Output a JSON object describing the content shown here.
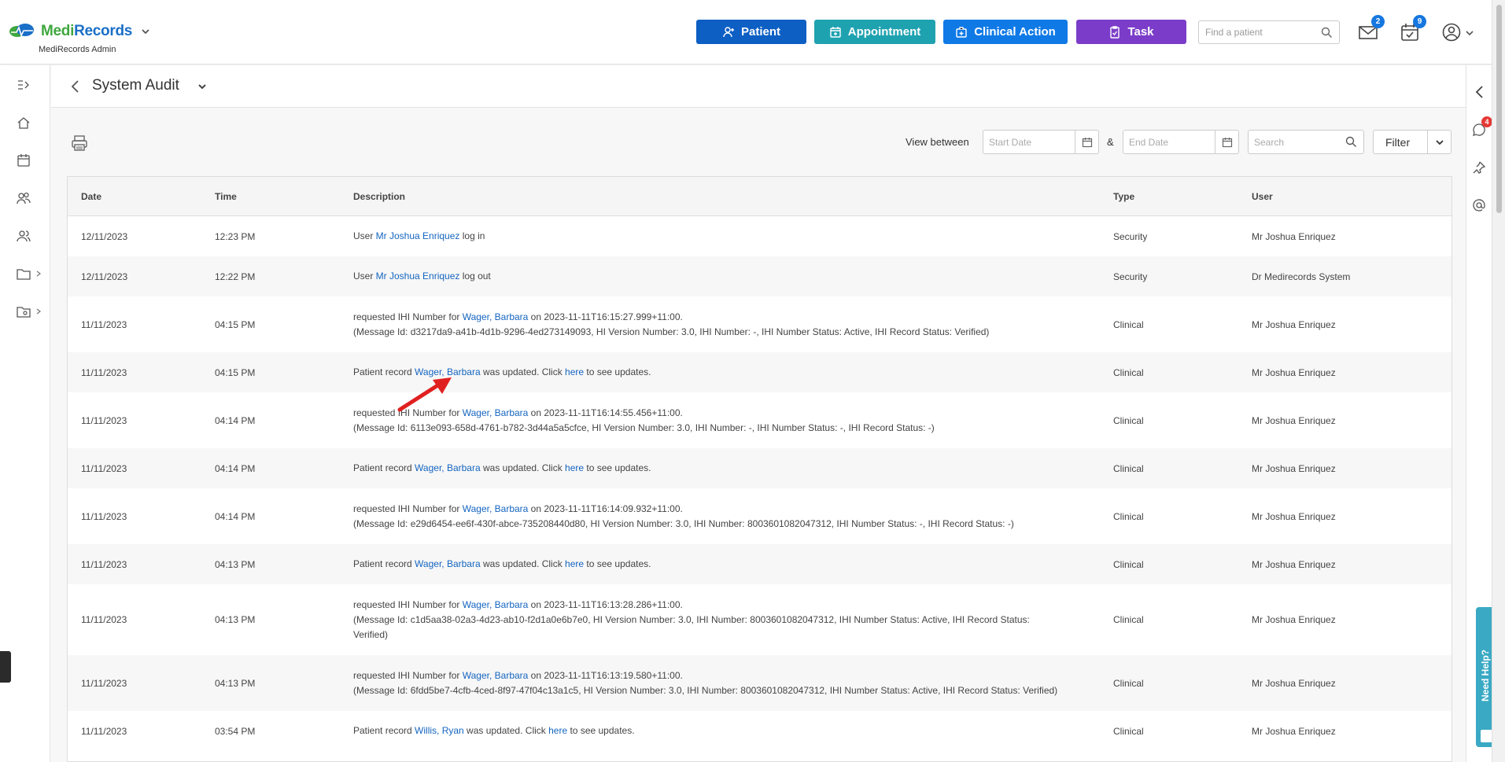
{
  "header": {
    "brand_medi": "Medi",
    "brand_records": "Records",
    "brand_sub": "MediRecords Admin",
    "buttons": {
      "patient": "Patient",
      "appointment": "Appointment",
      "clinical_action": "Clinical Action",
      "task": "Task"
    },
    "find_placeholder": "Find a patient",
    "mail_count": "2",
    "tasks_count": "9"
  },
  "colors": {
    "patient": "#0d5fc4",
    "appointment": "#1fa2b0",
    "clinical_action": "#0f79e6",
    "task": "#7b3dc9",
    "link": "#1565c0"
  },
  "right_rail": {
    "notification_count": "4",
    "need_help": "Need Help?"
  },
  "page": {
    "title": "System Audit"
  },
  "toolbar": {
    "view_between": "View between",
    "start_placeholder": "Start Date",
    "amp": "&",
    "end_placeholder": "End Date",
    "search_placeholder": "Search",
    "filter_value": "Filter"
  },
  "table": {
    "columns": [
      "Date",
      "Time",
      "Description",
      "Type",
      "User"
    ],
    "rows": [
      {
        "date": "12/11/2023",
        "time": "12:23 PM",
        "type": "Security",
        "user": "Mr Joshua Enriquez",
        "lines": [
          [
            {
              "t": "User "
            },
            {
              "t": "Mr Joshua Enriquez",
              "link": true
            },
            {
              "t": " log in"
            }
          ]
        ]
      },
      {
        "date": "12/11/2023",
        "time": "12:22 PM",
        "type": "Security",
        "user": "Dr Medirecords System",
        "lines": [
          [
            {
              "t": "User "
            },
            {
              "t": "Mr Joshua Enriquez",
              "link": true
            },
            {
              "t": " log out"
            }
          ]
        ]
      },
      {
        "date": "11/11/2023",
        "time": "04:15 PM",
        "type": "Clinical",
        "user": "Mr Joshua Enriquez",
        "lines": [
          [
            {
              "t": "requested IHI Number for "
            },
            {
              "t": "Wager, Barbara",
              "link": true
            },
            {
              "t": " on 2023-11-11T16:15:27.999+11:00."
            }
          ],
          [
            {
              "t": "(Message Id: d3217da9-a41b-4d1b-9296-4ed273149093, HI Version Number: 3.0, IHI Number: -, IHI Number Status: Active, IHI Record Status: Verified)"
            }
          ]
        ]
      },
      {
        "date": "11/11/2023",
        "time": "04:15 PM",
        "type": "Clinical",
        "user": "Mr Joshua Enriquez",
        "lines": [
          [
            {
              "t": "Patient record "
            },
            {
              "t": "Wager, Barbara",
              "link": true
            },
            {
              "t": " was updated. Click "
            },
            {
              "t": "here",
              "link": true
            },
            {
              "t": " to see updates."
            }
          ]
        ]
      },
      {
        "date": "11/11/2023",
        "time": "04:14 PM",
        "type": "Clinical",
        "user": "Mr Joshua Enriquez",
        "lines": [
          [
            {
              "t": "requested IHI Number for "
            },
            {
              "t": "Wager, Barbara",
              "link": true
            },
            {
              "t": " on 2023-11-11T16:14:55.456+11:00."
            }
          ],
          [
            {
              "t": "(Message Id: 6113e093-658d-4761-b782-3d44a5a5cfce, HI Version Number: 3.0, IHI Number: -, IHI Number Status: -, IHI Record Status: -)"
            }
          ]
        ]
      },
      {
        "date": "11/11/2023",
        "time": "04:14 PM",
        "type": "Clinical",
        "user": "Mr Joshua Enriquez",
        "lines": [
          [
            {
              "t": "Patient record "
            },
            {
              "t": "Wager, Barbara",
              "link": true
            },
            {
              "t": " was updated. Click "
            },
            {
              "t": "here",
              "link": true
            },
            {
              "t": " to see updates."
            }
          ]
        ]
      },
      {
        "date": "11/11/2023",
        "time": "04:14 PM",
        "type": "Clinical",
        "user": "Mr Joshua Enriquez",
        "lines": [
          [
            {
              "t": "requested IHI Number for "
            },
            {
              "t": "Wager, Barbara",
              "link": true
            },
            {
              "t": " on 2023-11-11T16:14:09.932+11:00."
            }
          ],
          [
            {
              "t": "(Message Id: e29d6454-ee6f-430f-abce-735208440d80, HI Version Number: 3.0, IHI Number: 8003601082047312, IHI Number Status: -, IHI Record Status: -)"
            }
          ]
        ]
      },
      {
        "date": "11/11/2023",
        "time": "04:13 PM",
        "type": "Clinical",
        "user": "Mr Joshua Enriquez",
        "lines": [
          [
            {
              "t": "Patient record "
            },
            {
              "t": "Wager, Barbara",
              "link": true
            },
            {
              "t": " was updated. Click "
            },
            {
              "t": "here",
              "link": true
            },
            {
              "t": " to see updates."
            }
          ]
        ]
      },
      {
        "date": "11/11/2023",
        "time": "04:13 PM",
        "type": "Clinical",
        "user": "Mr Joshua Enriquez",
        "lines": [
          [
            {
              "t": "requested IHI Number for "
            },
            {
              "t": "Wager, Barbara",
              "link": true
            },
            {
              "t": " on 2023-11-11T16:13:28.286+11:00."
            }
          ],
          [
            {
              "t": "(Message Id: c1d5aa38-02a3-4d23-ab10-f2d1a0e6b7e0, HI Version Number: 3.0, IHI Number: 8003601082047312, IHI Number Status: Active, IHI Record Status:"
            }
          ],
          [
            {
              "t": "Verified)"
            }
          ]
        ]
      },
      {
        "date": "11/11/2023",
        "time": "04:13 PM",
        "type": "Clinical",
        "user": "Mr Joshua Enriquez",
        "lines": [
          [
            {
              "t": "requested IHI Number for "
            },
            {
              "t": "Wager, Barbara",
              "link": true
            },
            {
              "t": " on 2023-11-11T16:13:19.580+11:00."
            }
          ],
          [
            {
              "t": "(Message Id: 6fdd5be7-4cfb-4ced-8f97-47f04c13a1c5, HI Version Number: 3.0, IHI Number: 8003601082047312, IHI Number Status: Active, IHI Record Status: Verified)"
            }
          ]
        ]
      },
      {
        "date": "11/11/2023",
        "time": "03:54 PM",
        "type": "Clinical",
        "user": "Mr Joshua Enriquez",
        "lines": [
          [
            {
              "t": "Patient record "
            },
            {
              "t": "Willis, Ryan",
              "link": true
            },
            {
              "t": " was updated. Click "
            },
            {
              "t": "here",
              "link": true
            },
            {
              "t": " to see updates."
            }
          ]
        ]
      }
    ]
  }
}
